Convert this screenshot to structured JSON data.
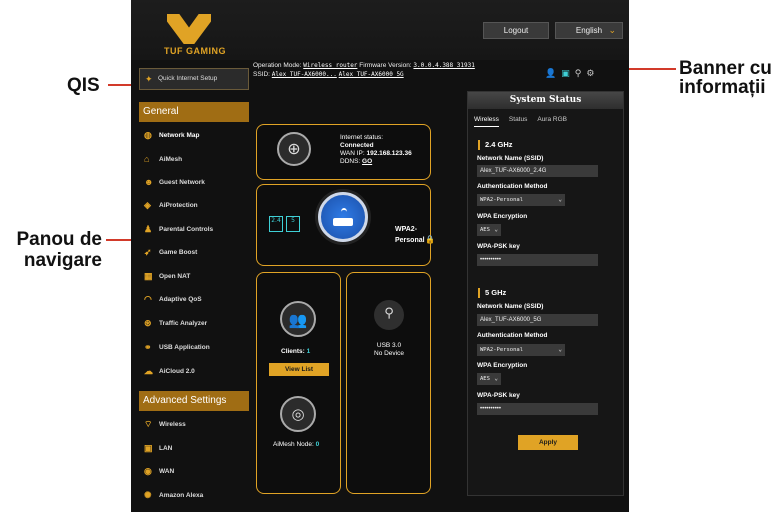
{
  "annotations": {
    "qis": "QIS",
    "nav_panel_line1": "Panou de",
    "nav_panel_line2": "navigare",
    "banner_line1": "Banner cu",
    "banner_line2": "informații"
  },
  "header": {
    "brand": "TUF GAMING",
    "logout": "Logout",
    "language": "English",
    "operation_mode_label": "Operation Mode:",
    "operation_mode_value": "Wireless router",
    "firmware_label": "Firmware Version:",
    "firmware_value": "3.0.0.4.388_31931",
    "ssid_label": "SSID:",
    "ssid_values": [
      "Alex_TUF-AX6000...",
      "Alex_TUF-AX6000_5G"
    ]
  },
  "sidebar": {
    "qis": "Quick Internet Setup",
    "general_header": "General",
    "general_items": [
      {
        "label": "Network Map",
        "icon": "network-map-icon"
      },
      {
        "label": "AiMesh",
        "icon": "aimesh-icon"
      },
      {
        "label": "Guest Network",
        "icon": "guest-network-icon"
      },
      {
        "label": "AiProtection",
        "icon": "aiprotection-icon"
      },
      {
        "label": "Parental Controls",
        "icon": "parental-controls-icon"
      },
      {
        "label": "Game Boost",
        "icon": "game-boost-icon"
      },
      {
        "label": "Open NAT",
        "icon": "open-nat-icon"
      },
      {
        "label": "Adaptive QoS",
        "icon": "adaptive-qos-icon"
      },
      {
        "label": "Traffic Analyzer",
        "icon": "traffic-analyzer-icon"
      },
      {
        "label": "USB Application",
        "icon": "usb-application-icon"
      },
      {
        "label": "AiCloud 2.0",
        "icon": "aicloud-icon"
      }
    ],
    "advanced_header": "Advanced Settings",
    "advanced_items": [
      {
        "label": "Wireless",
        "icon": "wireless-icon"
      },
      {
        "label": "LAN",
        "icon": "lan-icon"
      },
      {
        "label": "WAN",
        "icon": "wan-icon"
      },
      {
        "label": "Amazon Alexa",
        "icon": "amazon-alexa-icon"
      }
    ]
  },
  "network_map": {
    "internet_status_label": "Internet status:",
    "internet_status_value": "Connected",
    "wan_ip_label": "WAN IP:",
    "wan_ip_value": "192.168.123.36",
    "ddns_label": "DDNS:",
    "ddns_value": "GO",
    "security_line1": "WPA2-",
    "security_line2": "Personal",
    "band_24": "2.4",
    "band_5": "5",
    "clients_label": "Clients:",
    "clients_count": "1",
    "view_list": "View List",
    "aimesh_label": "AiMesh Node:",
    "aimesh_count": "0",
    "usb_label": "USB 3.0",
    "usb_status": "No Device"
  },
  "system_status": {
    "title": "System Status",
    "tabs": [
      "Wireless",
      "Status",
      "Aura RGB"
    ],
    "band24": {
      "heading": "2.4 GHz",
      "ssid_label": "Network Name (SSID)",
      "ssid_value": "Alex_TUF-AX6000_2.4G",
      "auth_label": "Authentication Method",
      "auth_value": "WPA2-Personal",
      "enc_label": "WPA Encryption",
      "enc_value": "AES",
      "key_label": "WPA-PSK key",
      "key_value": "••••••••••"
    },
    "band5": {
      "heading": "5 GHz",
      "ssid_label": "Network Name (SSID)",
      "ssid_value": "Alex_TUF-AX6000_5G",
      "auth_label": "Authentication Method",
      "auth_value": "WPA2-Personal",
      "enc_label": "WPA Encryption",
      "enc_value": "AES",
      "key_label": "WPA-PSK key",
      "key_value": "••••••••••"
    },
    "apply": "Apply"
  },
  "colors": {
    "accent": "#e0a325",
    "annotation_line": "#d23a2a",
    "router_blue": "#2f7be6"
  }
}
